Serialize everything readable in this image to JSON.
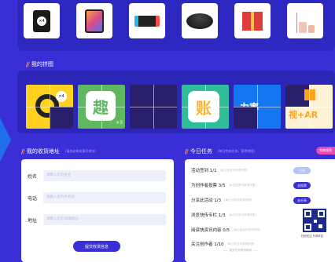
{
  "colors": {
    "background": "#3a2fd6",
    "panel": "#2e28c2",
    "accent_blue": "#3a2fd6",
    "accent_pink": "#e94bb3",
    "btn_light": "#6f8cf0"
  },
  "prizes": [
    {
      "name": "earbuds-case",
      "badge": "×4"
    },
    {
      "name": "tablet",
      "badge": ""
    },
    {
      "name": "game-console",
      "badge": ""
    },
    {
      "name": "robot-vacuum",
      "badge": ""
    },
    {
      "name": "gift-box",
      "badge": ""
    },
    {
      "name": "aroma-diffuser",
      "badge": ""
    }
  ],
  "puzzle_section": {
    "title": "我的拼图",
    "cards": [
      {
        "label": "×4",
        "bg": "#ffd21f"
      },
      {
        "label": "趣",
        "sub": "×3",
        "bg": "#5fb85f"
      },
      {
        "label": "",
        "bg": "#2a1f6b"
      },
      {
        "label": "账",
        "bg": "#2fbd9a"
      },
      {
        "label": "力率",
        "bg": "#1476f0"
      },
      {
        "label": "视+AR",
        "bg": "#fff3d6"
      }
    ]
  },
  "address_section": {
    "title": "我的收货地址",
    "note": "(请务必如实填写地址)",
    "fields": [
      {
        "label": "姓名",
        "placeholder": "请输入您的姓名"
      },
      {
        "label": "电话",
        "placeholder": "请输入您的手机号"
      },
      {
        "label": "地址",
        "placeholder": "请输入您的详细地址"
      }
    ],
    "submit_label": "提交收货信息"
  },
  "tasks_section": {
    "title": "今日任务",
    "note": "(单日完成任务，获得拼图)",
    "rules_label": "完善规则",
    "tasks": [
      {
        "name": "活动签到",
        "progress": "1/1",
        "note": "(每日签到可获得拼图)",
        "button": "已完",
        "btn_color": "#b7c4f5"
      },
      {
        "name": "为创作者投票",
        "progress": "3/5",
        "note": "(每日投票可获得拼图)",
        "button": "去投票",
        "btn_color": "#3a2fd6"
      },
      {
        "name": "分享此活动",
        "progress": "1/3",
        "note": "(每日分享可获得拼图)",
        "button": "去分享",
        "btn_color": "#3a2fd6"
      },
      {
        "name": "浏览快传专栏",
        "progress": "1/3",
        "note": "(每日浏览可获得拼图)",
        "button": "",
        "btn_color": ""
      },
      {
        "name": "阅读快资讯内容",
        "progress": "0/5",
        "note": "(每日阅读可获得拼图)",
        "button": "",
        "btn_color": ""
      },
      {
        "name": "关注创作者",
        "progress": "1/10",
        "note": "(每日关注可获得拼图)",
        "button": "",
        "btn_color": ""
      }
    ],
    "footer": "—— 更多任务敬请期待 ——",
    "qr_caption": "扫码关注 分享好友"
  }
}
